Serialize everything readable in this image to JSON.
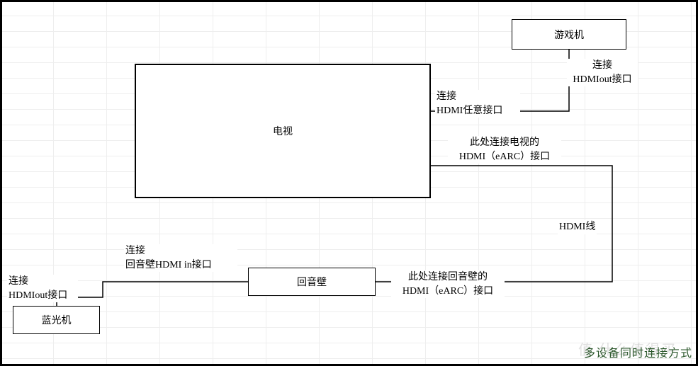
{
  "devices": {
    "tv": "电视",
    "console": "游戏机",
    "soundbar": "回音壁",
    "bluray": "蓝光机"
  },
  "labels": {
    "console_out_1": "连接",
    "console_out_2": "HDMIout接口",
    "tv_any_1": "连接",
    "tv_any_2": "HDMI任意接口",
    "tv_earc_1": "此处连接电视的",
    "tv_earc_2": "HDMI（eARC）接口",
    "hdmi_cable": "HDMI线",
    "sb_earc_1": "此处连接回音壁的",
    "sb_earc_2": "HDMI（eARC）接口",
    "sb_in_1": "连接",
    "sb_in_2": "回音壁HDMI in接口",
    "br_out_1": "连接",
    "br_out_2": "HDMIout接口"
  },
  "title": "多设备同时连接方式",
  "watermark": "值   什么值得买"
}
